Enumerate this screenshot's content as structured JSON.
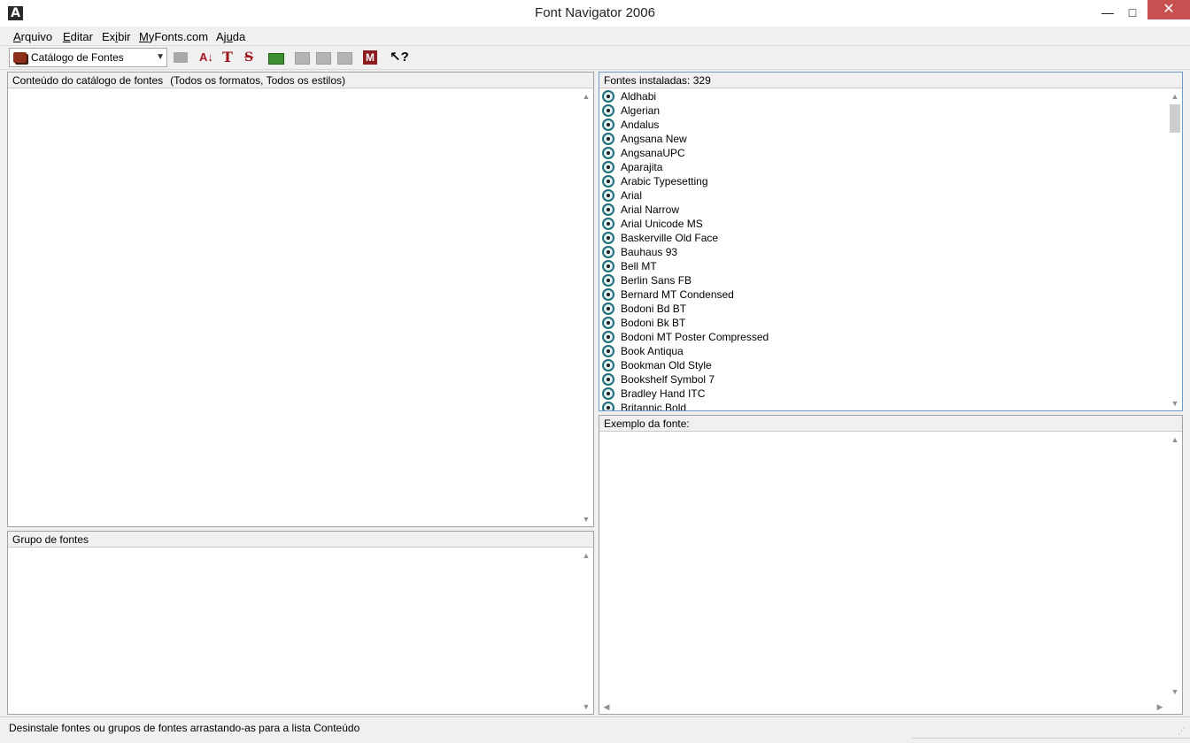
{
  "window": {
    "title": "Font Navigator 2006",
    "app_icon": "A",
    "controls": {
      "minimize": "—",
      "maximize": "□",
      "close": "✕"
    }
  },
  "menubar": {
    "items": [
      {
        "accel": "A",
        "rest": "rquivo"
      },
      {
        "accel": "E",
        "rest": "ditar"
      },
      {
        "pre": "Ex",
        "accel": "i",
        "rest": "bir"
      },
      {
        "accel": "M",
        "rest": "yFonts.com"
      },
      {
        "pre": "Aj",
        "accel": "u",
        "rest": "da"
      }
    ]
  },
  "toolbar": {
    "catalog_combo": "Catálogo de Fontes",
    "sort_icon": "az-sort-icon",
    "text_icon": "T",
    "strike_icon": "S",
    "m_icon": "M",
    "help_icon": "↖?"
  },
  "catalog_pane": {
    "title": "Conteúdo do catálogo de fontes",
    "subtitle": "(Todos os formatos, Todos os estilos)"
  },
  "group_pane": {
    "title": "Grupo de fontes"
  },
  "installed_pane": {
    "title": "Fontes instaladas: 329",
    "fonts": [
      "Aldhabi",
      "Algerian",
      "Andalus",
      "Angsana New",
      "AngsanaUPC",
      "Aparajita",
      "Arabic Typesetting",
      "Arial",
      "Arial Narrow",
      "Arial Unicode MS",
      "Baskerville Old Face",
      "Bauhaus 93",
      "Bell MT",
      "Berlin Sans FB",
      "Bernard MT Condensed",
      "Bodoni Bd BT",
      "Bodoni Bk BT",
      "Bodoni MT Poster Compressed",
      "Book Antiqua",
      "Bookman Old Style",
      "Bookshelf Symbol 7",
      "Bradley Hand ITC",
      "Britannic Bold"
    ]
  },
  "sample_pane": {
    "title": "Exemplo da fonte:"
  },
  "status": {
    "text": "Desinstale fontes ou grupos de fontes arrastando-as para a lista Conteúdo"
  },
  "colors": {
    "accent_red": "#a0141e",
    "close_button": "#c75050",
    "font_icon": "#1f6f7a"
  }
}
